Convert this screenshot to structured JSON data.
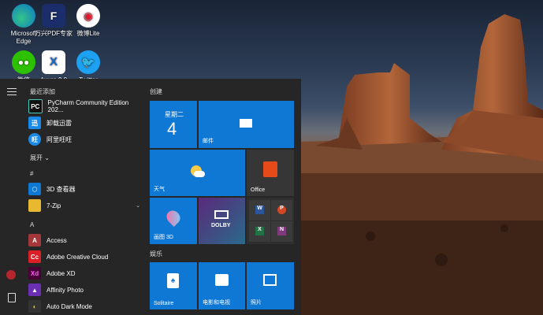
{
  "desktop": {
    "icons": [
      {
        "label1": "Microsoft",
        "label2": "Edge"
      },
      {
        "label1": "万兴PDF专家",
        "label2": ""
      },
      {
        "label1": "微博Lite",
        "label2": ""
      },
      {
        "label1": "微信",
        "label2": ""
      },
      {
        "label1": "Axure 9.0",
        "label2": ""
      },
      {
        "label1": "Twitter",
        "label2": ""
      }
    ]
  },
  "start_menu": {
    "recent_header": "最近添加",
    "recent": [
      {
        "label": "PyCharm Community Edition 202...",
        "icon": "pycharm-icon",
        "abbr": "PC"
      },
      {
        "label": "卸载迅雷",
        "icon": "uninstall-icon",
        "abbr": "迅"
      },
      {
        "label": "阿里旺旺",
        "icon": "aliwangwang-icon",
        "abbr": "旺"
      }
    ],
    "expand": "展开",
    "hash_header": "#",
    "hash_apps": [
      {
        "label": "3D 查看器",
        "icon": "3d-viewer-icon"
      },
      {
        "label": "7-Zip",
        "icon": "folder-icon",
        "chevron": "⌄"
      }
    ],
    "a_header": "A",
    "a_apps": [
      {
        "label": "Access",
        "icon": "access-icon",
        "abbr": "A"
      },
      {
        "label": "Adobe Creative Cloud",
        "icon": "adobe-cc-icon",
        "abbr": "Cc"
      },
      {
        "label": "Adobe XD",
        "icon": "adobe-xd-icon",
        "abbr": "Xd"
      },
      {
        "label": "Affinity Photo",
        "icon": "affinity-photo-icon",
        "abbr": "▲"
      },
      {
        "label": "Auto Dark Mode",
        "icon": "auto-dark-mode-icon",
        "abbr": "◐"
      }
    ]
  },
  "tiles": {
    "group_create": "创建",
    "group_entertainment": "娱乐",
    "calendar_day": "星期二",
    "calendar_date": "4",
    "mail": "邮件",
    "weather": "天气",
    "office": "Office",
    "paint3d": "画图 3D",
    "dolby": "DOLBY",
    "solitaire": "Solitaire",
    "movies": "电影和电视",
    "photos": "照片"
  },
  "colors": {
    "tile_blue": "#0f78d4",
    "menu_bg": "#262626"
  }
}
